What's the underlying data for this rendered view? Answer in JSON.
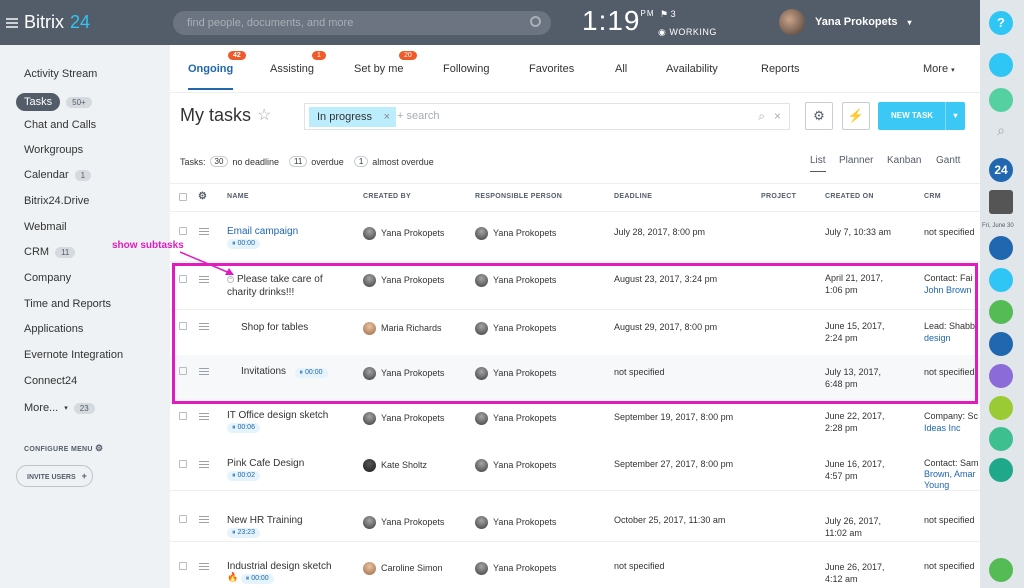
{
  "app": {
    "logo_a": "Bitrix",
    "logo_b": "24",
    "search_placeholder": "find people, documents, and more",
    "time": "1:19",
    "ampm": "PM",
    "flag_count": "3",
    "status": "WORKING",
    "user_name": "Yana Prokopets"
  },
  "sidebar": [
    {
      "label": "Activity Stream"
    },
    {
      "label": "Tasks",
      "count": "50+",
      "active": true
    },
    {
      "label": "Chat and Calls"
    },
    {
      "label": "Workgroups"
    },
    {
      "label": "Calendar",
      "count": "1"
    },
    {
      "label": "Bitrix24.Drive"
    },
    {
      "label": "Webmail"
    },
    {
      "label": "CRM",
      "count": "11"
    },
    {
      "label": "Company"
    },
    {
      "label": "Time and Reports"
    },
    {
      "label": "Applications"
    },
    {
      "label": "Evernote Integration"
    },
    {
      "label": "Connect24"
    },
    {
      "label": "More...",
      "count": "23"
    }
  ],
  "configure": "CONFIGURE MENU",
  "invite": "INVITE USERS",
  "tabs": [
    {
      "label": "Ongoing",
      "badge": "42",
      "active": true
    },
    {
      "label": "Assisting",
      "badge": "1"
    },
    {
      "label": "Set by me",
      "badge": "20"
    },
    {
      "label": "Following"
    },
    {
      "label": "Favorites"
    },
    {
      "label": "All"
    },
    {
      "label": "Availability"
    },
    {
      "label": "Reports"
    },
    {
      "label": "More"
    }
  ],
  "page_title": "My tasks",
  "filter": {
    "chip": "In progress",
    "placeholder": "+ search"
  },
  "new_task": "NEW TASK",
  "counters": {
    "label": "Tasks:",
    "c1": "30",
    "t1": "no deadline",
    "c2": "11",
    "t2": "overdue",
    "c3": "1",
    "t3": "almost overdue"
  },
  "views": [
    "List",
    "Planner",
    "Kanban",
    "Gantt"
  ],
  "columns": [
    "NAME",
    "CREATED BY",
    "RESPONSIBLE PERSON",
    "DEADLINE",
    "PROJECT",
    "CREATED ON",
    "CRM"
  ],
  "rows": [
    {
      "name": "Email campaign",
      "timer": "00:00",
      "created_by": "Yana Prokopets",
      "responsible": "Yana Prokopets",
      "deadline": "July 28, 2017, 8:00 pm",
      "created_on": "July 7, 10:33 am",
      "crm": "not specified"
    },
    {
      "name": "Please take care of",
      "name2": "charity drinks!!!",
      "created_by": "Yana Prokopets",
      "responsible": "Yana Prokopets",
      "deadline": "August 23, 2017, 3:24 pm",
      "created_on": "April 21, 2017,",
      "created_on2": "1:06 pm",
      "crm": "Contact: Fai",
      "crm2": "John Brown"
    },
    {
      "name": "Shop for tables",
      "created_by": "Maria Richards",
      "responsible": "Yana Prokopets",
      "deadline": "August 29, 2017, 8:00 pm",
      "created_on": "June 15, 2017,",
      "created_on2": "2:24 pm",
      "crm": "Lead: Shabb",
      "crm2": "design"
    },
    {
      "name": "Invitations",
      "timer": "00:00",
      "created_by": "Yana Prokopets",
      "responsible": "Yana Prokopets",
      "deadline": "not specified",
      "created_on": "July 13, 2017,",
      "created_on2": "6:48 pm",
      "crm": "not specified"
    },
    {
      "name": "IT Office design sketch",
      "timer": "00:06",
      "created_by": "Yana Prokopets",
      "responsible": "Yana Prokopets",
      "deadline": "September 19, 2017, 8:00 pm",
      "created_on": "June 22, 2017,",
      "created_on2": "2:28 pm",
      "crm": "Company: Sc",
      "crm2": "Ideas Inc"
    },
    {
      "name": "Pink Cafe Design",
      "timer": "00:02",
      "created_by": "Kate Sholtz",
      "responsible": "Yana Prokopets",
      "deadline": "September 27, 2017, 8:00 pm",
      "created_on": "June 16, 2017,",
      "created_on2": "4:57 pm",
      "crm": "Contact: Sam",
      "crm2": "Brown, Amar",
      "crm3": "Young"
    },
    {
      "name": "New HR Training",
      "timer": "23:23",
      "created_by": "Yana Prokopets",
      "responsible": "Yana Prokopets",
      "deadline": "October 25, 2017, 11:30 am",
      "created_on": "July 26, 2017,",
      "created_on2": "11:02 am",
      "crm": "not specified"
    },
    {
      "name": "Industrial design sketch",
      "timer": "00:00",
      "created_by": "Caroline Simon",
      "responsible": "Yana Prokopets",
      "deadline": "not specified",
      "created_on": "June 26, 2017,",
      "created_on2": "4:12 am",
      "crm": "not specified"
    }
  ],
  "annotation": "show subtasks",
  "right_date": "Fri, June 30",
  "right_24": "24",
  "help": "?"
}
